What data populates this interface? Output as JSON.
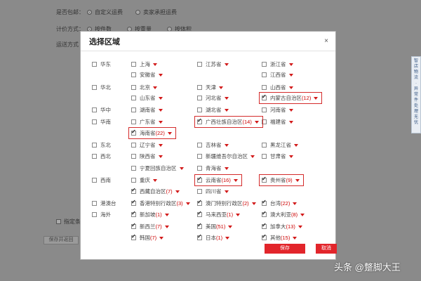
{
  "background": {
    "row1": {
      "label": "是否包邮：",
      "opt1": "自定义运费",
      "opt2": "卖家承担运费"
    },
    "row2": {
      "label": "计价方式：",
      "opt1": "按件数",
      "opt2": "按重量",
      "opt3": "按体积"
    },
    "row3": {
      "label": "运送方式"
    },
    "checkbox_label": "指定条",
    "button_label": "保存并返回"
  },
  "side_tab": {
    "chars": [
      "智",
      "店",
      "物",
      "流",
      "·",
      "异",
      "常",
      "件",
      "处",
      "理",
      "无",
      "忧"
    ]
  },
  "modal": {
    "title": "选择区域",
    "close": "×",
    "save_label": "保存",
    "cancel_label": "取消"
  },
  "regions": [
    {
      "key": "huadong",
      "name": "华东",
      "checked": false,
      "provinces": [
        {
          "name": "上海",
          "checked": false,
          "count": ""
        },
        {
          "name": "江苏省",
          "checked": false,
          "count": ""
        },
        {
          "name": "浙江省",
          "checked": false,
          "count": ""
        },
        {
          "name": "安徽省",
          "checked": false,
          "count": ""
        },
        {
          "name": "江西省",
          "checked": false,
          "count": ""
        }
      ]
    },
    {
      "key": "huabei",
      "name": "华北",
      "checked": false,
      "provinces": [
        {
          "name": "北京",
          "checked": false,
          "count": ""
        },
        {
          "name": "天津",
          "checked": false,
          "count": ""
        },
        {
          "name": "山西省",
          "checked": false,
          "count": ""
        },
        {
          "name": "山东省",
          "checked": false,
          "count": ""
        },
        {
          "name": "河北省",
          "checked": false,
          "count": ""
        },
        {
          "name": "内蒙古自治区",
          "checked": true,
          "count": "(12)"
        }
      ]
    },
    {
      "key": "huazhong",
      "name": "华中",
      "checked": false,
      "provinces": [
        {
          "name": "湖南省",
          "checked": false,
          "count": ""
        },
        {
          "name": "湖北省",
          "checked": false,
          "count": ""
        },
        {
          "name": "河南省",
          "checked": false,
          "count": ""
        }
      ]
    },
    {
      "key": "huanan",
      "name": "华南",
      "checked": false,
      "provinces": [
        {
          "name": "广东省",
          "checked": false,
          "count": ""
        },
        {
          "name": "广西壮族自治区",
          "checked": true,
          "count": "(14)"
        },
        {
          "name": "福建省",
          "checked": false,
          "count": ""
        },
        {
          "name": "海南省",
          "checked": true,
          "count": "(22)"
        }
      ]
    },
    {
      "key": "dongbei",
      "name": "东北",
      "checked": false,
      "provinces": [
        {
          "name": "辽宁省",
          "checked": false,
          "count": ""
        },
        {
          "name": "吉林省",
          "checked": false,
          "count": ""
        },
        {
          "name": "黑龙江省",
          "checked": false,
          "count": ""
        }
      ]
    },
    {
      "key": "xibei",
      "name": "西北",
      "checked": false,
      "provinces": [
        {
          "name": "陕西省",
          "checked": false,
          "count": ""
        },
        {
          "name": "新疆维吾尔自治区",
          "checked": false,
          "count": ""
        },
        {
          "name": "甘肃省",
          "checked": false,
          "count": ""
        },
        {
          "name": "宁夏回族自治区",
          "checked": false,
          "count": ""
        },
        {
          "name": "青海省",
          "checked": false,
          "count": ""
        }
      ]
    },
    {
      "key": "xinan",
      "name": "西南",
      "checked": false,
      "provinces": [
        {
          "name": "重庆",
          "checked": false,
          "count": ""
        },
        {
          "name": "云南省",
          "checked": true,
          "count": "(16)"
        },
        {
          "name": "贵州省",
          "checked": true,
          "count": "(9)"
        },
        {
          "name": "西藏自治区",
          "checked": true,
          "count": "(7)"
        },
        {
          "name": "四川省",
          "checked": false,
          "count": ""
        }
      ]
    },
    {
      "key": "gangaotai",
      "name": "港澳台",
      "checked": false,
      "provinces": [
        {
          "name": "香港特别行政区",
          "checked": true,
          "count": "(3)"
        },
        {
          "name": "澳门特别行政区",
          "checked": true,
          "count": "(2)"
        },
        {
          "name": "台湾",
          "checked": true,
          "count": "(22)"
        }
      ]
    },
    {
      "key": "haiwai",
      "name": "海外",
      "checked": false,
      "provinces": [
        {
          "name": "新加坡",
          "checked": true,
          "count": "(1)"
        },
        {
          "name": "马来西亚",
          "checked": true,
          "count": "(1)"
        },
        {
          "name": "澳大利亚",
          "checked": true,
          "count": "(8)"
        },
        {
          "name": "新西兰",
          "checked": true,
          "count": "(7)"
        },
        {
          "name": "美国",
          "checked": true,
          "count": "(51)"
        },
        {
          "name": "加拿大",
          "checked": true,
          "count": "(13)"
        },
        {
          "name": "韩国",
          "checked": true,
          "count": "(7)"
        },
        {
          "name": "日本",
          "checked": true,
          "count": "(1)"
        },
        {
          "name": "其他",
          "checked": true,
          "count": "(15)"
        }
      ]
    }
  ],
  "watermark": "头条 @蹩脚大王",
  "colors": {
    "accent": "#e2252b",
    "highlight": "#d42b2b"
  }
}
